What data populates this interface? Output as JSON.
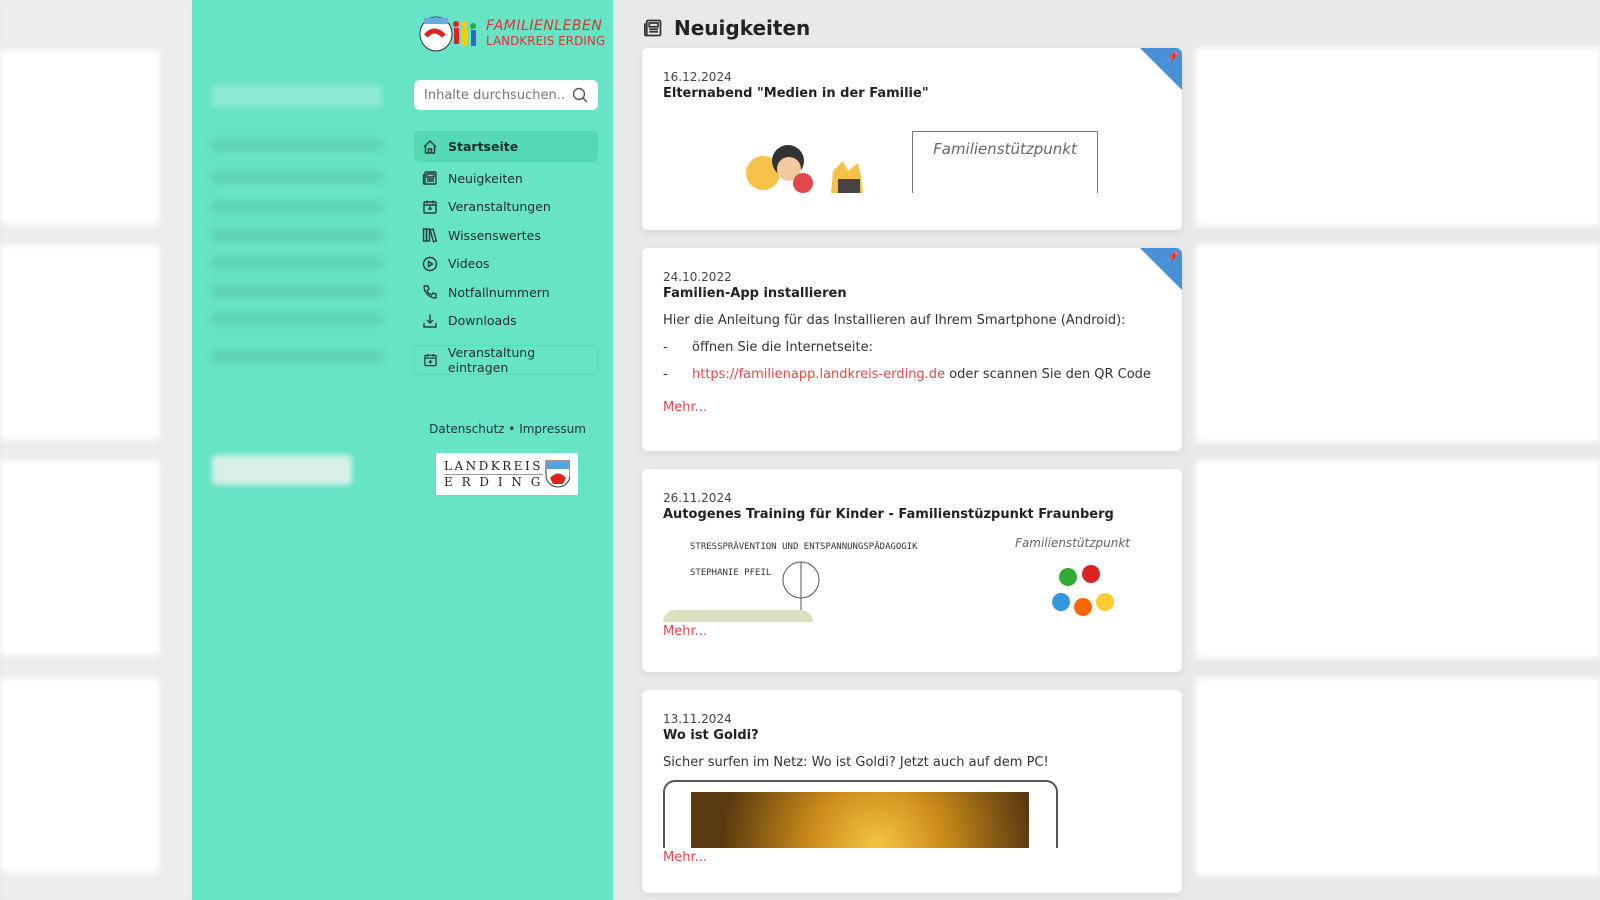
{
  "sidebar": {
    "logo_line1": "FAMILIENLEBEN",
    "logo_line2": "LANDKREIS ERDING",
    "search_placeholder": "Inhalte durchsuchen...",
    "items": [
      {
        "label": "Startseite",
        "icon": "home-icon",
        "active": true
      },
      {
        "label": "Neuigkeiten",
        "icon": "newspaper-icon"
      },
      {
        "label": "Veranstaltungen",
        "icon": "calendar-star-icon"
      },
      {
        "label": "Wissenswertes",
        "icon": "books-icon"
      },
      {
        "label": "Videos",
        "icon": "play-circle-icon"
      },
      {
        "label": "Notfallnummern",
        "icon": "phone-icon"
      },
      {
        "label": "Downloads",
        "icon": "download-icon"
      }
    ],
    "add_event": "Veranstaltung eintragen",
    "datenschutz": "Datenschutz",
    "separator": "•",
    "impressum": "Impressum",
    "partner_logo_line1": "LANDKREIS",
    "partner_logo_line2": "ERDING"
  },
  "main": {
    "title": "Neuigkeiten",
    "posts": [
      {
        "date": "16.12.2024",
        "title": "Elternabend \"Medien in der Familie\"",
        "pinned": true,
        "image_text": "Familienstützpunkt"
      },
      {
        "date": "24.10.2022",
        "title": "Familien-App installieren",
        "pinned": true,
        "text": "Hier die Anleitung für das Installieren auf Ihrem Smartphone (Android):",
        "list": [
          "öffnen Sie die Internetseite:"
        ],
        "link": "https://familienapp.landkreis-erding.de",
        "link_suffix": " oder scannen Sie den QR Code",
        "bullet": "-",
        "more": "Mehr..."
      },
      {
        "date": "26.11.2024",
        "title": "Autogenes Training für Kinder - Familienstüzpunkt Fraunberg",
        "image_text1": "STRESSPRÄVENTION UND ENTSPANNUNGSPÄDAGOGIK",
        "image_text2": "STEPHANIE PFEIL",
        "image_text3": "Familienstützpunkt",
        "more": "Mehr..."
      },
      {
        "date": "13.11.2024",
        "title": "Wo ist Goldi?",
        "text": "Sicher surfen im Netz: Wo ist Goldi? Jetzt auch auf dem PC!",
        "more": "Mehr..."
      }
    ]
  },
  "colors": {
    "sidebar": "#67e3c6",
    "accent_link": "#e2474b",
    "pin": "#4a90d9"
  }
}
